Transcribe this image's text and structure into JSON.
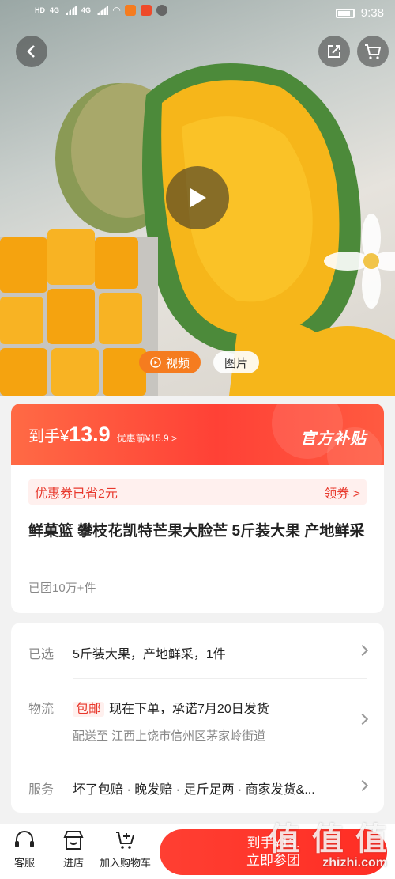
{
  "status_bar": {
    "time": "9:38",
    "network_left": "HD",
    "network_mid": "4G"
  },
  "colors": {
    "accent": "#ff4136",
    "video_tab": "#f57c1f",
    "coupon_text": "#e8382c"
  },
  "hero": {
    "back_icon": "chevron-left-icon",
    "share_icon": "share-icon",
    "cart_icon": "cart-icon",
    "play_icon": "play-icon",
    "tabs": {
      "video": "视频",
      "photo": "图片"
    }
  },
  "price": {
    "label": "到手¥",
    "value": "13.9",
    "original": "优惠前¥15.9 >",
    "badge": "官方补贴"
  },
  "coupon": {
    "text": "优惠券已省2元",
    "action": "领券 >"
  },
  "product": {
    "title": "鲜菓篮 攀枝花凯特芒果大脸芒 5斤装大果 产地鲜采",
    "sold": "已团10万+件"
  },
  "options": {
    "selected_key": "已选",
    "selected_val": "5斤装大果，产地鲜采，1件",
    "logistics_key": "物流",
    "logistics_badge": "包邮",
    "logistics_val": "现在下单，承诺7月20日发货",
    "delivery_to": "配送至  江西上饶市信州区茅家岭街道",
    "service_key": "服务",
    "service_val": "坏了包赔 · 晚发赔 · 足斤足两 · 商家发货&..."
  },
  "bottom": {
    "service": "客服",
    "store": "进店",
    "add_cart": "加入购物车",
    "buy_line1": "到手¥13.",
    "buy_line2": "立即参团"
  },
  "watermark": {
    "text": "值 值 值",
    "url": "zhizhi.com"
  }
}
